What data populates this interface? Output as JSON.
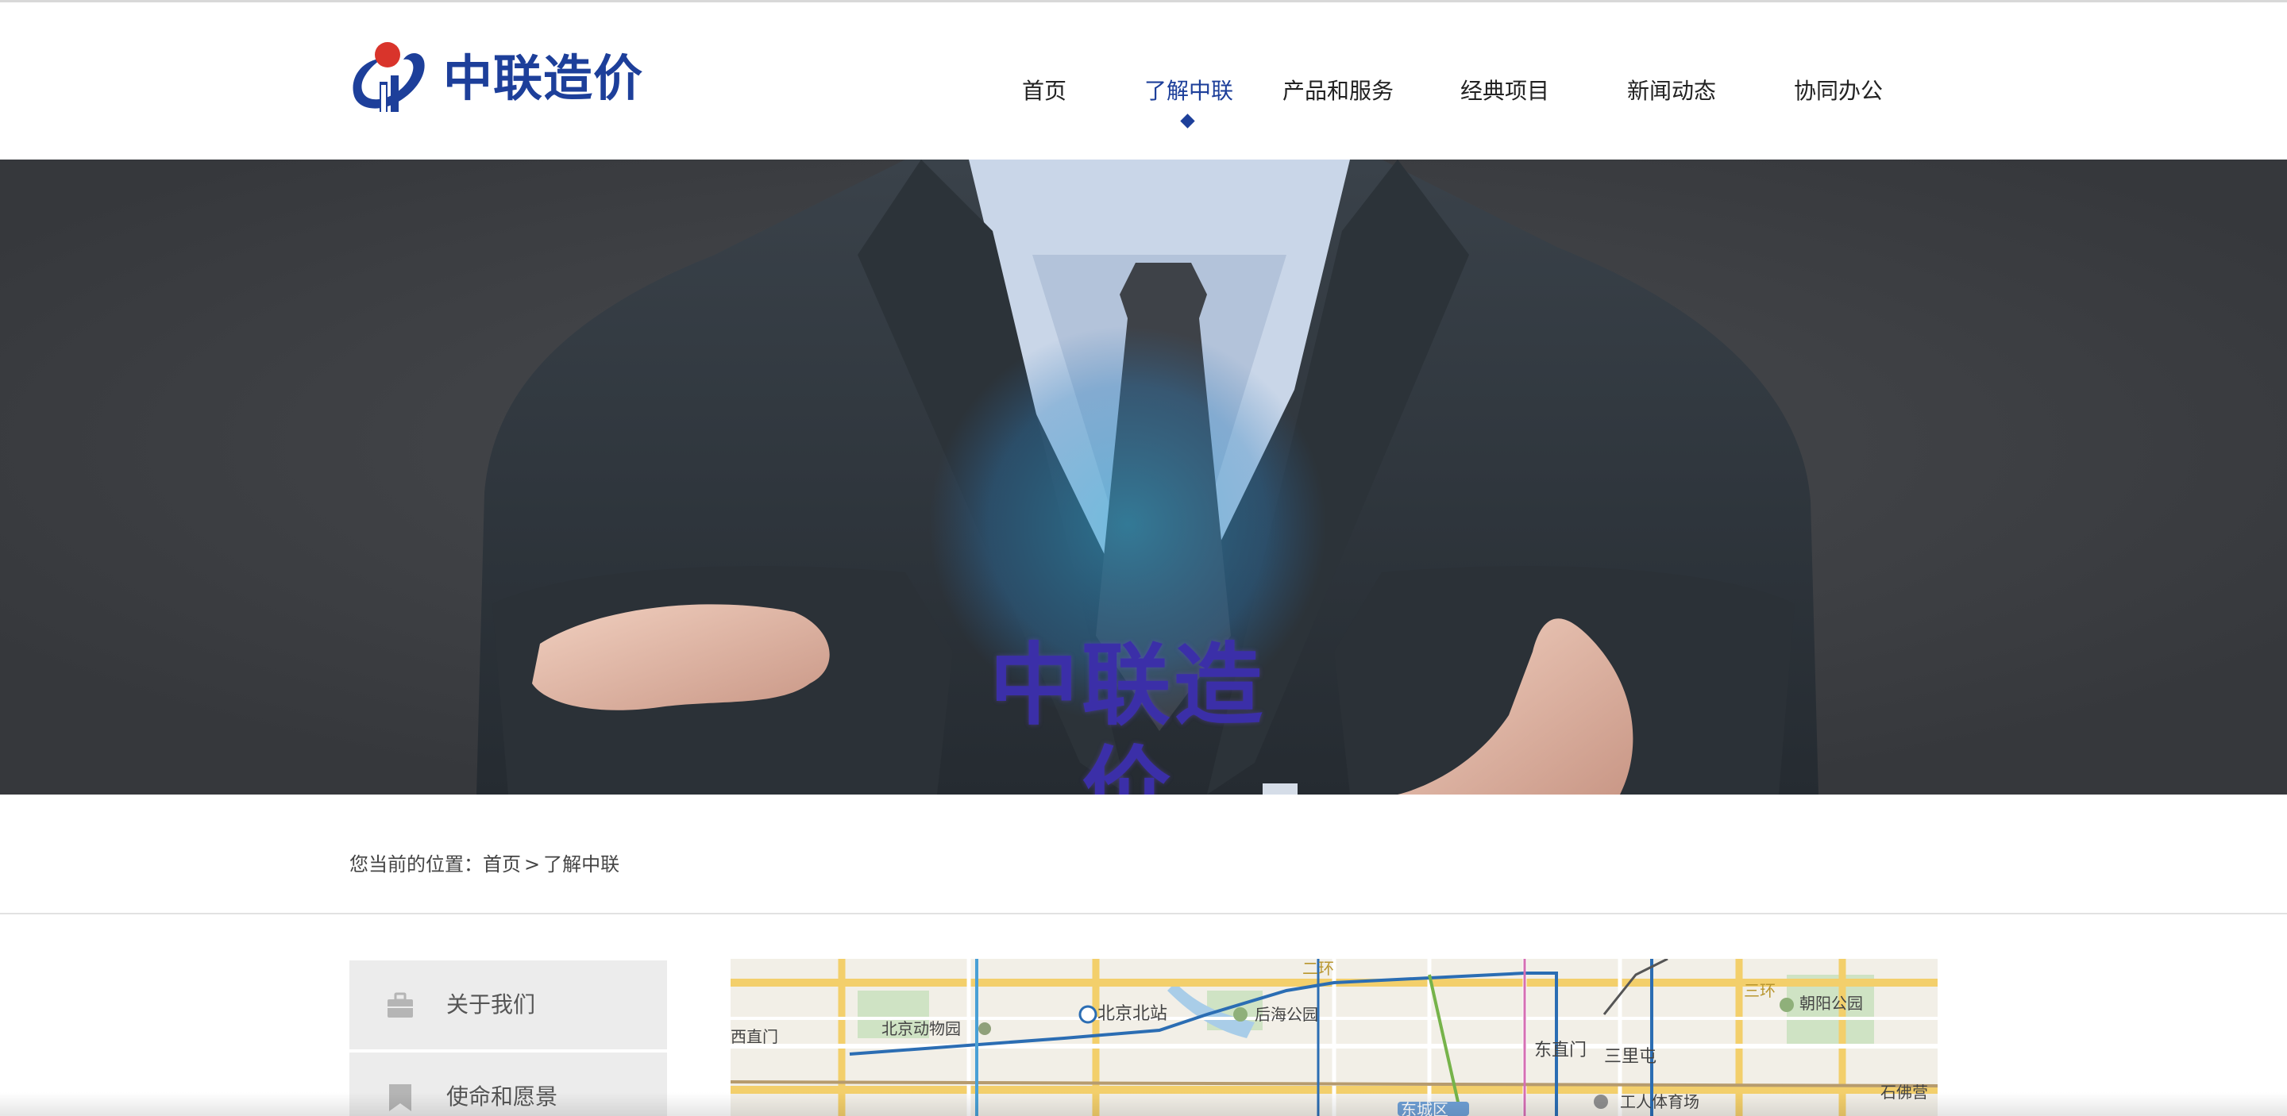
{
  "brand": {
    "logo_icon": "zhonglian-logo-icon",
    "logo_text": "中联造价",
    "brand_color": "#1d3f9a",
    "accent_red": "#d9342b"
  },
  "nav": {
    "items": [
      {
        "label": "首页"
      },
      {
        "label": "了解中联"
      },
      {
        "label": "产品和服务"
      },
      {
        "label": "经典项目"
      },
      {
        "label": "新闻动态"
      },
      {
        "label": "协同办公"
      }
    ],
    "active_index": 1
  },
  "banner": {
    "title": "中联造价",
    "title_color": "#3b2fa8",
    "background_color": "#3d3f43"
  },
  "breadcrumb": {
    "prefix": "您当前的位置：",
    "home": "首页",
    "separator": ">",
    "current": "了解中联"
  },
  "sidebar": {
    "items": [
      {
        "label": "关于我们",
        "icon": "briefcase-icon"
      },
      {
        "label": "使命和愿景",
        "icon": "bookmark-icon"
      }
    ]
  },
  "map": {
    "labels": {
      "xizhimen": "西直门",
      "zoo": "北京动物园",
      "north_station": "北京北站",
      "houhai": "后海公园",
      "dongzhimen": "东直门",
      "sanlitun": "三里屯",
      "chaoyang_park": "朝阳公园",
      "workers_stadium": "工人体育场",
      "dongcheng": "东城区",
      "shifoying": "石佛营",
      "ring2": "二环",
      "ring3": "三环"
    }
  }
}
